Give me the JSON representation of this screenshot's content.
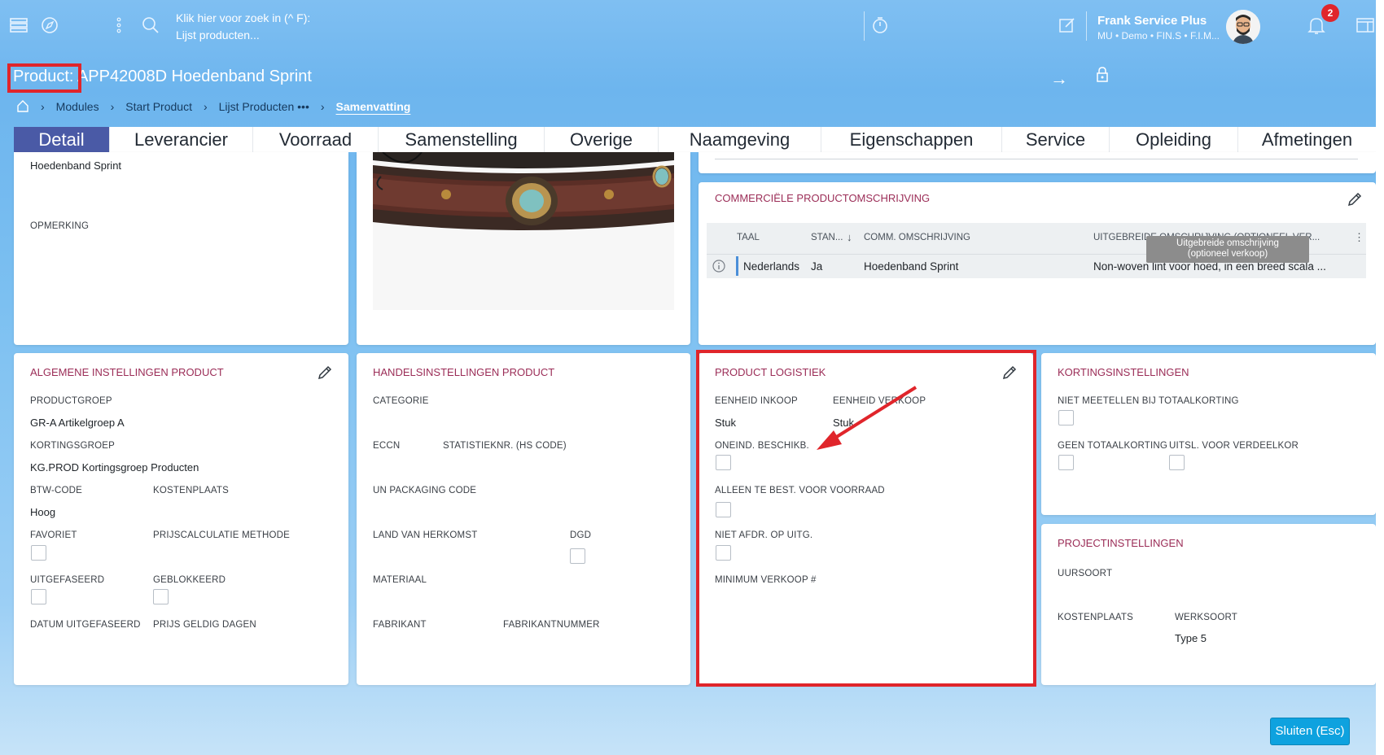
{
  "topbar": {
    "search_line1": "Klik hier voor zoek in (^ F):",
    "search_line2": "Lijst producten...",
    "user_name": "Frank Service Plus",
    "user_sub": "MU • Demo • FIN.S • F.I.M...",
    "notification_count": "2"
  },
  "title": {
    "prefix": "Product:",
    "text": "APP42008D Hoedenband Sprint"
  },
  "breadcrumb": {
    "items": [
      "Modules",
      "Start Product",
      "Lijst Producten •••"
    ],
    "active": "Samenvatting"
  },
  "tabs": [
    "Detail",
    "Leverancier",
    "Voorraad",
    "Samenstelling",
    "Overige",
    "Naamgeving",
    "Eigenschappen",
    "Service",
    "Opleiding",
    "Afmetingen"
  ],
  "top_left_panel": {
    "value": "Hoedenband Sprint",
    "label_opmerking": "OPMERKING"
  },
  "commercieel": {
    "title": "COMMERCIËLE PRODUCTOMSCHRIJVING",
    "headers": [
      "TAAL",
      "STAN...",
      "COMM. OMSCHRIJVING",
      "UITGEBREIDE OMSCHRIJVING (OPTIONEEL VER..."
    ],
    "row": [
      "Nederlands",
      "Ja",
      "Hoedenband Sprint",
      "Non-woven lint voor hoed, in een breed scala ..."
    ],
    "tooltip_line1": "Uitgebreide omschrijving",
    "tooltip_line2": "(optioneel verkoop)"
  },
  "algemene": {
    "title": "ALGEMENE INSTELLINGEN PRODUCT",
    "productgroep_label": "PRODUCTGROEP",
    "productgroep_value": "GR-A Artikelgroep A",
    "kortingsgroep_label": "KORTINGSGROEP",
    "kortingsgroep_value": "KG.PROD Kortingsgroep Producten",
    "btw_label": "BTW-CODE",
    "btw_value": "Hoog",
    "kostenplaats_label": "KOSTENPLAATS",
    "favoriet_label": "FAVORIET",
    "prijscalc_label": "PRIJSCALCULATIE METHODE",
    "uitgefaseerd_label": "UITGEFASEERD",
    "geblokkeerd_label": "GEBLOKKEERD",
    "datum_label": "DATUM UITGEFASEERD",
    "prijs_geldig_label": "PRIJS GELDIG DAGEN"
  },
  "handel": {
    "title": "HANDELSINSTELLINGEN PRODUCT",
    "categorie": "CATEGORIE",
    "eccn": "ECCN",
    "statistieknr": "STATISTIEKNR. (HS CODE)",
    "un_packaging": "UN PACKAGING CODE",
    "land": "LAND VAN HERKOMST",
    "dgd": "DGD",
    "materiaal": "MATERIAAL",
    "fabrikant": "FABRIKANT",
    "fabrikantnummer": "FABRIKANTNUMMER"
  },
  "logistiek": {
    "title": "PRODUCT LOGISTIEK",
    "eenheid_inkoop_label": "EENHEID INKOOP",
    "eenheid_inkoop_value": "Stuk",
    "eenheid_verkoop_label": "EENHEID VERKOOP",
    "eenheid_verkoop_value": "Stuk",
    "oneind_label": "ONEIND. BESCHIKB.",
    "alleen_label": "ALLEEN TE BEST. VOOR VOORRAAD",
    "niet_afdr_label": "NIET AFDR. OP UITG.",
    "minimum_label": "MINIMUM VERKOOP #"
  },
  "korting": {
    "title": "KORTINGSINSTELLINGEN",
    "niet_meetellen": "NIET MEETELLEN BIJ TOTAALKORTING",
    "geen_totaal": "GEEN TOTAALKORTING",
    "uitsl": "UITSL. VOOR VERDEELKOR"
  },
  "project": {
    "title": "PROJECTINSTELLINGEN",
    "uursoort": "UURSOORT",
    "kostenplaats": "KOSTENPLAATS",
    "werksoort": "WERKSOORT",
    "werksoort_value": "Type 5"
  },
  "close_button": "Sluiten (Esc)",
  "colors": {
    "accent": "#9b2d57",
    "tab_active": "#4a5aa6",
    "highlight": "#e0252b",
    "close_button": "#0ea2df"
  }
}
